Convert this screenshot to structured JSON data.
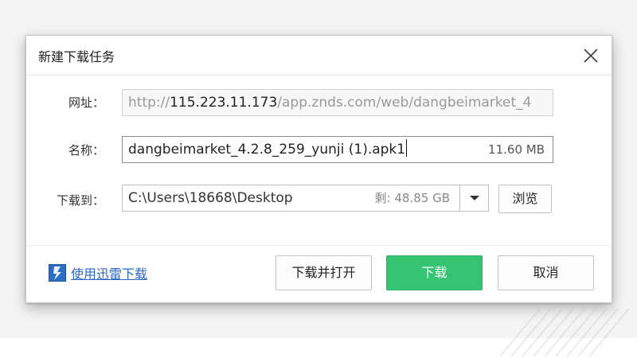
{
  "dialog": {
    "title": "新建下载任务",
    "url_label": "网址：",
    "url_prefix": "http://",
    "url_host": "115.223.11.173",
    "url_rest": "/app.znds.com/web/dangbeimarket_4",
    "name_label": "名称：",
    "name_value": "dangbeimarket_4.2.8_259_yunji (1).apk1",
    "file_size": "11.60 MB",
    "dest_label": "下载到：",
    "dest_path": "C:\\Users\\18668\\Desktop",
    "free_space": "剩: 48.85 GB",
    "browse_label": "浏览",
    "thunder_link": "使用迅雷下载",
    "download_open_label": "下载并打开",
    "download_label": "下载",
    "cancel_label": "取消"
  },
  "icons": {
    "close": "close-icon",
    "dropdown": "chevron-down-icon",
    "thunder": "thunder-logo-icon"
  },
  "colors": {
    "primary_button": "#35c472",
    "link": "#2d67c6"
  }
}
